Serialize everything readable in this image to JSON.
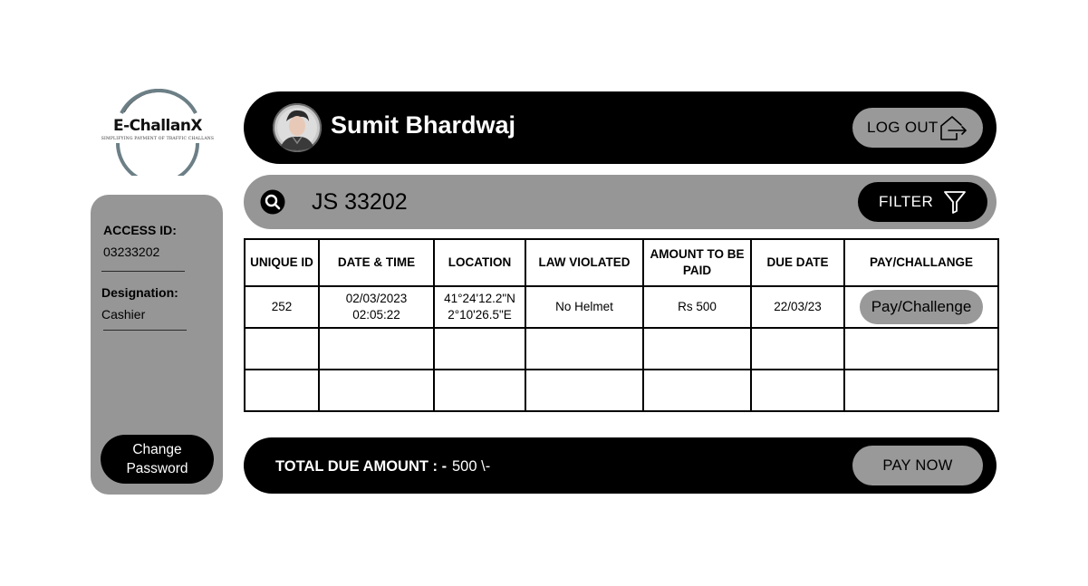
{
  "brand": {
    "name": "E-ChallanX",
    "tagline": "Simplifying Payment of Traffic Challans"
  },
  "sidebar": {
    "access_id_label": "ACCESS ID:",
    "access_id_value": "03233202",
    "designation_label": "Designation:",
    "designation_value": "Cashier",
    "change_password_label": "Change Password"
  },
  "header": {
    "user_name": "Sumit Bhardwaj",
    "logout_label": "LOG OUT"
  },
  "search": {
    "value": "JS 33202",
    "filter_label": "FILTER"
  },
  "table": {
    "columns": [
      "UNIQUE ID",
      "DATE & TIME",
      "LOCATION",
      "LAW VIOLATED",
      "AMOUNT TO BE PAID",
      "DUE DATE",
      "PAY/CHALLANGE"
    ],
    "rows": [
      {
        "unique_id": "252",
        "date": "02/03/2023",
        "time": "02:05:22",
        "location_lat": "41°24'12.2\"N",
        "location_lon": "2°10'26.5\"E",
        "law_violated": "No Helmet",
        "amount": "Rs 500",
        "due_date": "22/03/23",
        "action_label": "Pay/Challenge"
      }
    ]
  },
  "footer": {
    "total_label": "TOTAL DUE AMOUNT  : -",
    "total_value": "500 \\-",
    "pay_now_label": "PAY NOW"
  },
  "colors": {
    "dark": "#000000",
    "panel_gray": "#969696",
    "button_gray": "#999999",
    "background": "#ffffff"
  },
  "icons": {
    "logout": "logout-icon",
    "search": "search-icon",
    "filter": "filter-icon",
    "avatar": "avatar"
  }
}
